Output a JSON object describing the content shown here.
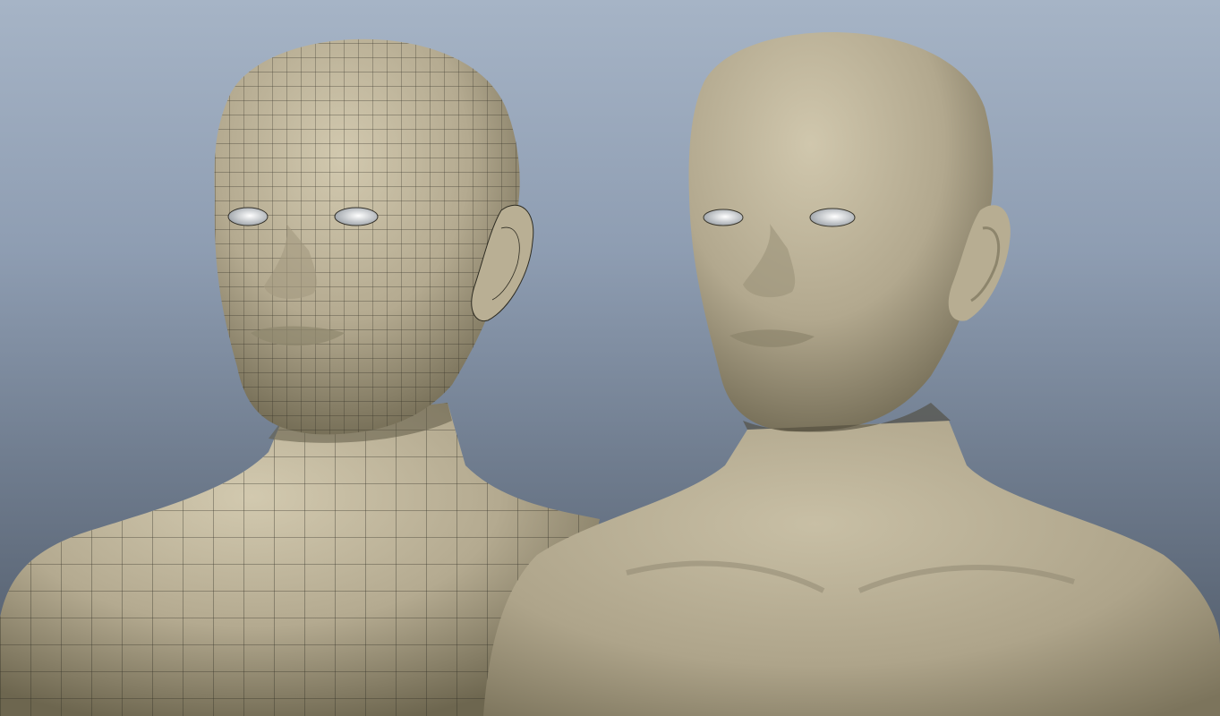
{
  "scene": {
    "background_top": "#a6b4c6",
    "background_bottom": "#4e5866",
    "skin_color": "#b6ad94",
    "wire_color": "#2a2a22",
    "eye_color": "#e6e8ea"
  },
  "models": [
    {
      "id": "wireframe",
      "render": "wireframe-on-shaded"
    },
    {
      "id": "smooth",
      "render": "smooth-shaded"
    }
  ]
}
